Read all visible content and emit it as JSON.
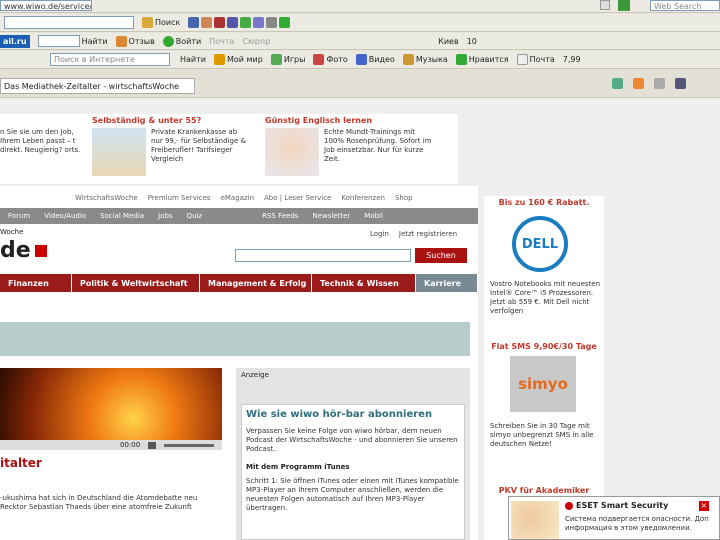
{
  "browser": {
    "address": "www.wiwo.de/service/audio/",
    "search_button": "Поиск",
    "web_search_placeholder": "Web Search",
    "mail_brand": "ail.ru",
    "find_button": "Найти",
    "rating_label": "Отзыв",
    "login_label": "Войти",
    "mail_label": "Почта",
    "notes_label": "Сюрпр",
    "mail_search_placeholder": "Поиск в Интернете",
    "find2": "Найти",
    "myworld": "Мой мир",
    "games": "Игры",
    "photo": "Фото",
    "video": "Видео",
    "music": "Музыка",
    "like": "Нравится",
    "mail2": "Почта",
    "price": "7,99",
    "city": "Киев",
    "temp": "10",
    "tab_title": "Das Mediathek-Zeitalter - wirtschaftsWoche"
  },
  "teasers": [
    {
      "title": "",
      "text": "n Sie sie um den Job, Ihrem Leben passt – t direkt. Neugierig? orts."
    },
    {
      "title": "Selbständig & unter 55?",
      "text": "Private Krankenkasse ab nur 99,- für Selbständige & Freiberufler! Tarifsieger Vergleich"
    },
    {
      "title": "Günstig Englisch lernen",
      "text": "Echte Mundt-Trainings mit 100% Rosenprüfung. Sofort im Job einsetzbar. Nur für kurze Zeit."
    }
  ],
  "site": {
    "top_links": [
      "WirtschaftsWoche",
      "Premium Services",
      "eMagazin",
      "Abo | Leser Service",
      "Konferenzen",
      "Shop"
    ],
    "sub_links": [
      "Forum",
      "Video/Audio",
      "Social Media",
      "Jobs",
      "Quiz"
    ],
    "feed_links": [
      "RSS Feeds",
      "Newsletter",
      "Mobil"
    ],
    "brand_top": "Woche",
    "brand": "de",
    "login": "Login",
    "register": "Jetzt registrieren",
    "search_button": "Suchen",
    "tabs": [
      "Finanzen",
      "Politik & Weltwirtschaft",
      "Management & Erfolg",
      "Technik & Wissen",
      "Karriere"
    ],
    "player_time": "00:00",
    "headline": "italter",
    "article_text": "-ukushima hat sich in Deutschland die Atomdebatte neu Recktor Sebastian Thaeds über eine atomfreie Zukunft",
    "ad_label": "Anzeige",
    "box_title": "Wie sie wiwo hör-bar abonnieren",
    "box_text": "Verpassen Sie keine Folge von wiwo hörbar, dem neuen Podcast der WirtschaftsWoche - und abonnieren Sie unseren Podcast.",
    "box_subhead": "Mit dem Programm iTunes",
    "box_text2": "Schritt 1: Sie öffnen iTunes oder einen mit iTunes kompatible MP3-Player an Ihrem Computer anschließen, werden die neuesten Folgen automatisch auf Ihren MP3-Player übertragen."
  },
  "sidebar": [
    {
      "head": "Bis zu 160 € Rabatt.",
      "logo": "DELL",
      "text": "Vostro Notebooks mit neuesten Intel® Core™ i5 Prozessoren. Jetzt ab 559 €. Mit Dell nicht verfolgen"
    },
    {
      "head": "Flat SMS 9,90€/30 Tage",
      "logo": "simyo",
      "text": "Schreiben Sie in 30 Tage mit simyo unbegrenzt SMS in alle deutschen Netze!"
    },
    {
      "head": "PKV für Akademiker",
      "logo": "",
      "text": ""
    }
  ],
  "popup": {
    "title": "ESET Smart Security",
    "text": "Система подвергается опасности. Доп информация в этом уведомлении."
  },
  "colors": {
    "red": "#c0392b",
    "tabgray": "#8b8b8b",
    "tabred": "#9b1b1b",
    "teal": "#b8cccc"
  }
}
